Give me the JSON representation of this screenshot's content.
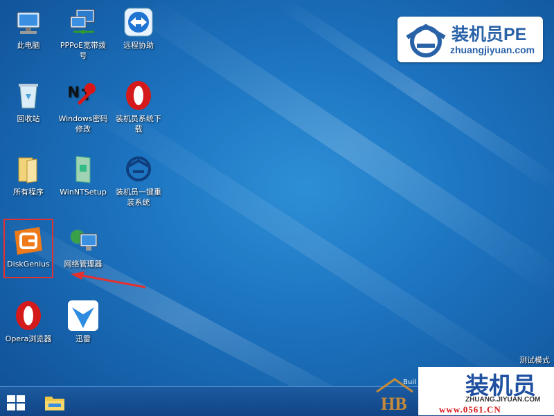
{
  "desktop": {
    "icons": [
      {
        "id": "this-pc",
        "label": "此电脑"
      },
      {
        "id": "pppoe",
        "label": "PPPoE宽带拨号"
      },
      {
        "id": "remote-assist",
        "label": "远程协助"
      },
      {
        "id": "recycle-bin",
        "label": "回收站"
      },
      {
        "id": "windows-password",
        "label": "Windows密码修改"
      },
      {
        "id": "zhuangjiyuan-download",
        "label": "装机员系统下载"
      },
      {
        "id": "all-programs",
        "label": "所有程序"
      },
      {
        "id": "winntsetup",
        "label": "WinNTSetup"
      },
      {
        "id": "one-click-reinstall",
        "label": "装机员一键重装系统"
      },
      {
        "id": "diskgenius",
        "label": "DiskGenius"
      },
      {
        "id": "network-manager",
        "label": "网络管理器"
      },
      {
        "id": "opera-browser",
        "label": "Opera浏览器"
      },
      {
        "id": "xunlei",
        "label": "迅雷"
      }
    ]
  },
  "logo": {
    "title": "装机员PE",
    "url": "zhuangjiyuan.com"
  },
  "status": {
    "test_mode": "测试模式"
  },
  "watermark": {
    "build": "Buil",
    "line1": "装机员",
    "line2": "ZHUANG.JIYUAN.COM",
    "line3": "www.0561.CN"
  },
  "colors": {
    "desktop": "#1d74c0",
    "taskbar": "#114586",
    "highlight": "#e53030",
    "logo_blue": "#2a62a8"
  }
}
